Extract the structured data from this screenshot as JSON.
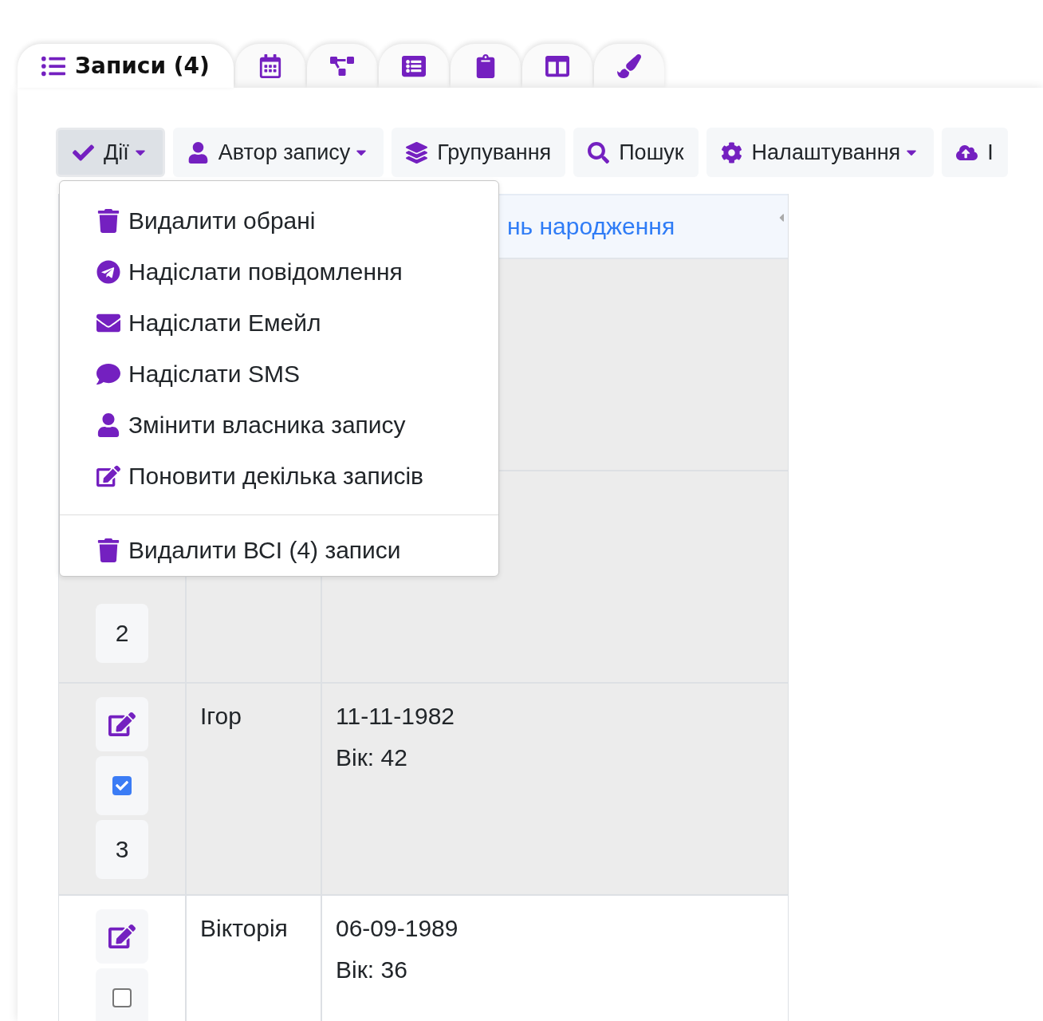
{
  "tabs": [
    {
      "label": "Записи (4)",
      "selected": true
    },
    {
      "selected": false
    },
    {
      "selected": false
    },
    {
      "selected": false
    },
    {
      "selected": false
    },
    {
      "selected": false
    },
    {
      "selected": false
    }
  ],
  "toolbar": [
    {
      "label": "Дії",
      "caret": true,
      "pressed": true
    },
    {
      "label": "Автор запису",
      "caret": true,
      "pressed": false
    },
    {
      "label": "Групування",
      "caret": false,
      "pressed": false
    },
    {
      "label": "Пошук",
      "caret": false,
      "pressed": false
    },
    {
      "label": "Налаштування",
      "caret": true,
      "pressed": false
    },
    {
      "label": "І",
      "caret": false,
      "pressed": false
    }
  ],
  "actions_menu": {
    "groups": [
      [
        "Видалити обрані",
        "Надіслати повідомлення",
        "Надіслати Емейл",
        "Надіслати SMS",
        "Змінити власника запису",
        "Поновити декілька записів"
      ],
      [
        "Видалити ВСІ (4) записи"
      ]
    ]
  },
  "table": {
    "header": {
      "column_3": "нь народження"
    },
    "rows": [
      {
        "selected": true
      },
      {
        "selected": true,
        "number": "2"
      },
      {
        "selected": true,
        "checked": true,
        "number": "3",
        "name": "Ігор",
        "date": "11-11-1982",
        "age": "Вік: 42"
      },
      {
        "selected": false,
        "checked": false,
        "name": "Вікторія",
        "date": "06-09-1989",
        "age": "Вік: 36"
      }
    ]
  }
}
